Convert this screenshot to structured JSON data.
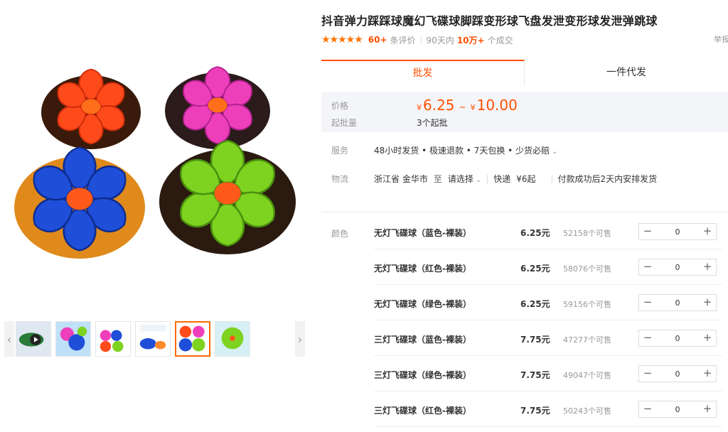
{
  "product": {
    "title": "抖音弹力踩踩球魔幻飞碟球脚踩变形球飞盘发泄变形球发泄弹跳球",
    "stars": "★★★★★",
    "review_count": "60+",
    "review_label": "条评价",
    "days_label": "90天内",
    "sold_count": "10万+",
    "sold_label": "个成交",
    "report_label": "举报"
  },
  "tabs": [
    {
      "label": "批发"
    },
    {
      "label": "一件代发"
    }
  ],
  "price": {
    "label": "价格",
    "currency": "¥",
    "low": "6.25",
    "tilde": "~",
    "high": "10.00",
    "moq_label": "起批量",
    "moq_value": "3个起批"
  },
  "service": {
    "label": "服务",
    "text": "48小时发货 • 极速退款 • 7天包换 • 少货必赔"
  },
  "logistics": {
    "label": "物流",
    "origin": "浙江省 金华市",
    "to": "至",
    "dest": "请选择",
    "method": "快递",
    "fee": "¥6起",
    "ship_note": "付款成功后2天内安排发货"
  },
  "sku": {
    "label": "颜色",
    "rows": [
      {
        "name": "无灯飞碟球（蓝色-裸装）",
        "price": "6.25元",
        "stock": "52158个可售",
        "qty": "0"
      },
      {
        "name": "无灯飞碟球（红色-裸装）",
        "price": "6.25元",
        "stock": "58076个可售",
        "qty": "0"
      },
      {
        "name": "无灯飞碟球（绿色-裸装）",
        "price": "6.25元",
        "stock": "59156个可售",
        "qty": "0"
      },
      {
        "name": "三灯飞碟球（蓝色-裸装）",
        "price": "7.75元",
        "stock": "47277个可售",
        "qty": "0"
      },
      {
        "name": "三灯飞碟球（绿色-裸装）",
        "price": "7.75元",
        "stock": "49047个可售",
        "qty": "0"
      },
      {
        "name": "三灯飞碟球（红色-裸装）",
        "price": "7.75元",
        "stock": "50243个可售",
        "qty": "0"
      }
    ],
    "minus": "−",
    "plus": "+"
  },
  "gallery": {
    "left_arrow": "‹",
    "right_arrow": "›",
    "colors": {
      "red": "#ff4a1c",
      "pink": "#ee3fbb",
      "blue": "#1f4fd8",
      "green": "#7ed321",
      "accent": "#ff5000"
    }
  }
}
